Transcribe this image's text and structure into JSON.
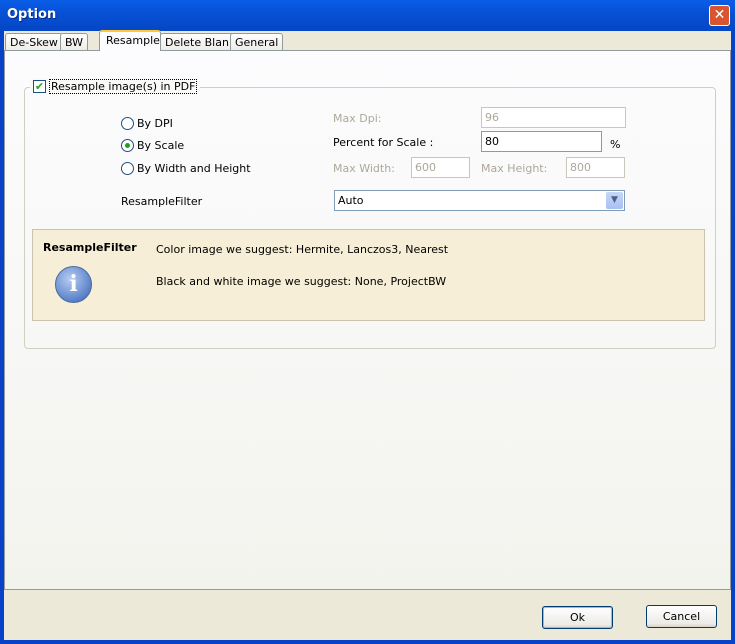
{
  "window": {
    "title": "Option",
    "close_icon": "close-icon"
  },
  "tabs": [
    {
      "label": "De-Skew"
    },
    {
      "label": "BW"
    },
    {
      "label": "Resample",
      "active": true
    },
    {
      "label": "Delete Blank"
    },
    {
      "label": "General"
    }
  ],
  "resample": {
    "enable_label": "Resample image(s) in PDF",
    "enabled": true,
    "modes": [
      {
        "label": "By DPI",
        "selected": false
      },
      {
        "label": "By Scale",
        "selected": true
      },
      {
        "label": "By Width and Height",
        "selected": false
      }
    ],
    "max_dpi_label": "Max Dpi:",
    "max_dpi_value": "96",
    "percent_label": "Percent for Scale :",
    "percent_value": "80",
    "percent_unit": "%",
    "max_width_label": "Max Width:",
    "max_width_value": "600",
    "max_height_label": "Max Height:",
    "max_height_value": "800",
    "filter_label": "ResampleFilter",
    "filter_value": "Auto"
  },
  "info": {
    "title": "ResampleFilter",
    "icon": "info-icon",
    "line1": "Color image we suggest: Hermite, Lanczos3, Nearest",
    "line2": "Black and white image we suggest: None, ProjectBW"
  },
  "footer": {
    "ok_label": "Ok",
    "cancel_label": "Cancel"
  },
  "colors": {
    "titlebar": "#0651d6",
    "info_bg": "#f6eed6",
    "tab_highlight": "#ffc83c"
  }
}
